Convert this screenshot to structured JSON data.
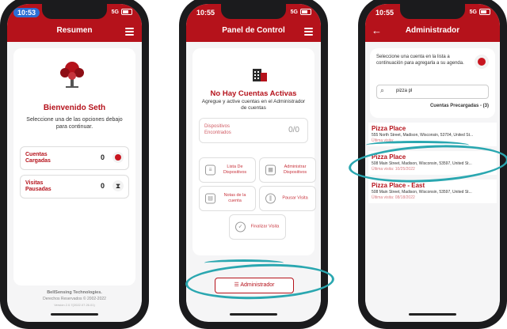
{
  "colors": {
    "brand": "#b5121b",
    "teal": "#2aa7b0"
  },
  "phone1": {
    "time": "10:53",
    "network": "5G",
    "title": "Resumen",
    "icon": "apple-tree-icon",
    "welcome": "Bienvenido Seth",
    "instructions": "Seleccione una de las opciones debajo para continuar.",
    "cuentas": {
      "label": "Cuentas Cargadas",
      "count": "0"
    },
    "visitas": {
      "label": "Visitas Pausadas",
      "count": "0"
    },
    "footer": {
      "company": "BellSensing Technologies.",
      "rights": "Derechos Reservados © 2002-2022",
      "version": "Versión 2.0.7(2022.07.26.01)"
    }
  },
  "phone2": {
    "time": "10:55",
    "network": "5G",
    "title": "Panel de Control",
    "no_accounts": "No Hay Cuentas Activas",
    "subtitle": "Agregue y active cuentas en el Administrador de cuentas",
    "devices": {
      "label": "Dispositivos Encontrados",
      "count": "0/0"
    },
    "buttons": [
      {
        "label": "Lista De Dispositivos",
        "icon": "list-icon"
      },
      {
        "label": "Administrar Dispositivos",
        "icon": "grid-icon"
      },
      {
        "label": "Notas de la cuenta",
        "icon": "clipboard-icon"
      },
      {
        "label": "Pausar Visita",
        "icon": "pause-icon"
      },
      {
        "label": "Finalizar Visita",
        "icon": "check-circle-icon"
      }
    ],
    "admin_button": "☰ Administrador"
  },
  "phone3": {
    "time": "10:55",
    "network": "5G",
    "title": "Administrador",
    "instructions": "Seleccione una cuenta en la lista a continuación para agregarla a su agenda.",
    "search_value": "pizza pl",
    "preloaded": "Cuentas Precargadas - (3)",
    "accounts": [
      {
        "name": "Pizza Place",
        "address": "555 North Street, Madison, Wisconsin, 53704, United St...",
        "last": "Última visita:"
      },
      {
        "name": "Pizza Place",
        "address": "508 Main Street, Madison, Wisconsin, 53597, United St...",
        "last": "Última visita: 10/25/2022"
      },
      {
        "name": "Pizza Place - East",
        "address": "508 Main Street, Madison, Wisconsin, 53597, United St...",
        "last": "Última visita: 08/18/2022"
      }
    ]
  }
}
